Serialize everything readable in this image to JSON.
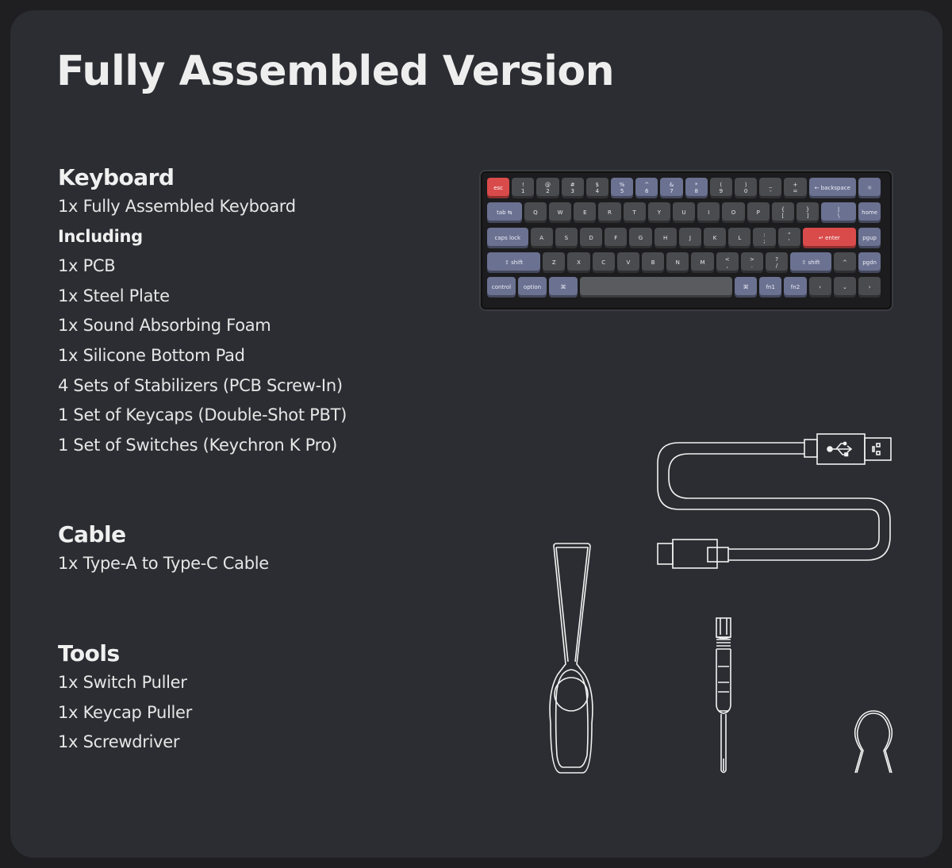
{
  "title": "Fully Assembled Version",
  "sections": {
    "keyboard": {
      "heading": "Keyboard",
      "items_top": [
        "1x Fully Assembled Keyboard"
      ],
      "subheading": "Including",
      "items": [
        "1x PCB",
        "1x Steel Plate",
        "1x Sound Absorbing Foam",
        "1x Silicone Bottom Pad",
        "4 Sets of Stabilizers (PCB Screw-In)",
        "1 Set of Keycaps (Double-Shot PBT)",
        "1 Set of Switches (Keychron K Pro)"
      ]
    },
    "cable": {
      "heading": "Cable",
      "items": [
        "1x Type-A to Type-C Cable"
      ]
    },
    "tools": {
      "heading": "Tools",
      "items": [
        "1x Switch Puller",
        "1x Keycap Puller",
        "1x Screwdriver"
      ]
    }
  },
  "colors": {
    "background": "#1f1f21",
    "card": "#2c2d32",
    "key_dark": "#4a4b4e",
    "key_blue": "#6a7191",
    "key_red": "#d94b4b"
  },
  "keyboard_keys": [
    [
      {
        "t": "esc",
        "c": "red",
        "w": 1
      },
      {
        "t": "!|1",
        "c": "dark",
        "w": 1
      },
      {
        "t": "@|2",
        "c": "dark",
        "w": 1
      },
      {
        "t": "#|3",
        "c": "dark",
        "w": 1
      },
      {
        "t": "$|4",
        "c": "dark",
        "w": 1
      },
      {
        "t": "%|5",
        "c": "blue",
        "w": 1
      },
      {
        "t": "^|6",
        "c": "blue",
        "w": 1
      },
      {
        "t": "&|7",
        "c": "blue",
        "w": 1
      },
      {
        "t": "*|8",
        "c": "blue",
        "w": 1
      },
      {
        "t": "(|9",
        "c": "dark",
        "w": 1
      },
      {
        "t": ")|0",
        "c": "dark",
        "w": 1
      },
      {
        "t": "_|-",
        "c": "dark",
        "w": 1
      },
      {
        "t": "+|=",
        "c": "dark",
        "w": 1
      },
      {
        "t": "← backspace",
        "c": "blue",
        "w": 2
      },
      {
        "t": "☼",
        "c": "blue",
        "w": 1
      }
    ],
    [
      {
        "t": "tab ⇆",
        "c": "blue",
        "w": 1.5
      },
      {
        "t": "Q",
        "c": "dark",
        "w": 1
      },
      {
        "t": "W",
        "c": "dark",
        "w": 1
      },
      {
        "t": "E",
        "c": "dark",
        "w": 1
      },
      {
        "t": "R",
        "c": "dark",
        "w": 1
      },
      {
        "t": "T",
        "c": "dark",
        "w": 1
      },
      {
        "t": "Y",
        "c": "dark",
        "w": 1
      },
      {
        "t": "U",
        "c": "dark",
        "w": 1
      },
      {
        "t": "I",
        "c": "dark",
        "w": 1
      },
      {
        "t": "O",
        "c": "dark",
        "w": 1
      },
      {
        "t": "P",
        "c": "dark",
        "w": 1
      },
      {
        "t": "{|[",
        "c": "dark",
        "w": 1
      },
      {
        "t": "}|]",
        "c": "dark",
        "w": 1
      },
      {
        "t": "||\\",
        "c": "blue",
        "w": 1.5
      },
      {
        "t": "home",
        "c": "blue",
        "w": 1
      }
    ],
    [
      {
        "t": "caps lock",
        "c": "blue",
        "w": 1.75
      },
      {
        "t": "A",
        "c": "dark",
        "w": 1
      },
      {
        "t": "S",
        "c": "dark",
        "w": 1
      },
      {
        "t": "D",
        "c": "dark",
        "w": 1
      },
      {
        "t": "F",
        "c": "dark",
        "w": 1
      },
      {
        "t": "G",
        "c": "dark",
        "w": 1
      },
      {
        "t": "H",
        "c": "dark",
        "w": 1
      },
      {
        "t": "J",
        "c": "dark",
        "w": 1
      },
      {
        "t": "K",
        "c": "dark",
        "w": 1
      },
      {
        "t": "L",
        "c": "dark",
        "w": 1
      },
      {
        "t": ":|;",
        "c": "dark",
        "w": 1
      },
      {
        "t": "\"|'",
        "c": "dark",
        "w": 1
      },
      {
        "t": "↵ enter",
        "c": "red",
        "w": 2.25
      },
      {
        "t": "pgup",
        "c": "blue",
        "w": 1
      }
    ],
    [
      {
        "t": "⇧ shift",
        "c": "blue",
        "w": 2.25
      },
      {
        "t": "Z",
        "c": "dark",
        "w": 1
      },
      {
        "t": "X",
        "c": "dark",
        "w": 1
      },
      {
        "t": "C",
        "c": "dark",
        "w": 1
      },
      {
        "t": "V",
        "c": "dark",
        "w": 1
      },
      {
        "t": "B",
        "c": "dark",
        "w": 1
      },
      {
        "t": "N",
        "c": "dark",
        "w": 1
      },
      {
        "t": "M",
        "c": "dark",
        "w": 1
      },
      {
        "t": "<|,",
        "c": "dark",
        "w": 1
      },
      {
        "t": ">|.",
        "c": "dark",
        "w": 1
      },
      {
        "t": "?|/",
        "c": "dark",
        "w": 1
      },
      {
        "t": "⇧ shift",
        "c": "blue",
        "w": 1.75
      },
      {
        "t": "^",
        "c": "dark",
        "w": 1
      },
      {
        "t": "pgdn",
        "c": "blue",
        "w": 1
      }
    ],
    [
      {
        "t": "control",
        "c": "blue",
        "w": 1.25
      },
      {
        "t": "option",
        "c": "blue",
        "w": 1.25
      },
      {
        "t": "⌘",
        "c": "blue",
        "w": 1.25
      },
      {
        "t": "",
        "c": "space",
        "w": 6.25
      },
      {
        "t": "⌘",
        "c": "blue",
        "w": 1
      },
      {
        "t": "fn1",
        "c": "blue",
        "w": 1
      },
      {
        "t": "fn2",
        "c": "blue",
        "w": 1
      },
      {
        "t": "‹",
        "c": "dark",
        "w": 1
      },
      {
        "t": "⌄",
        "c": "dark",
        "w": 1
      },
      {
        "t": "›",
        "c": "dark",
        "w": 1
      }
    ]
  ]
}
